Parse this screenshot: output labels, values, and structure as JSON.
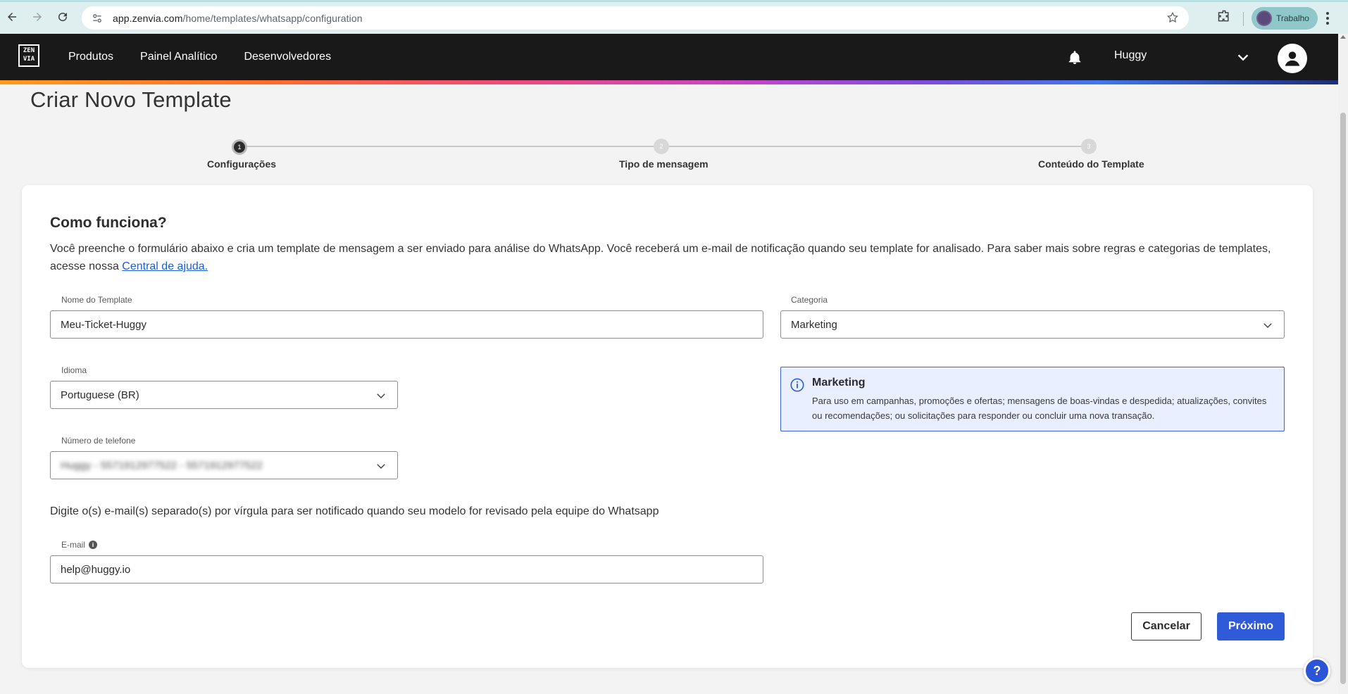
{
  "browser": {
    "url_host": "app.zenvia.com",
    "url_path": "/home/templates/whatsapp/configuration",
    "profile_label": "Trabalho",
    "icons": [
      "back-icon",
      "forward-icon",
      "reload-icon",
      "site-settings-icon",
      "bookmark-star-icon",
      "extensions-icon",
      "menu-kebab-icon"
    ]
  },
  "header": {
    "logo_text": "ZEN VIA",
    "nav": [
      "Produtos",
      "Painel Analítico",
      "Desenvolvedores"
    ],
    "account_name": "Huggy",
    "icons": [
      "bell-icon",
      "chevron-down-icon",
      "user-avatar-icon"
    ]
  },
  "page": {
    "title": "Criar Novo Template"
  },
  "stepper": {
    "steps": [
      {
        "number": "1",
        "label": "Configurações",
        "active": true
      },
      {
        "number": "2",
        "label": "Tipo de mensagem",
        "active": false
      },
      {
        "number": "3",
        "label": "Conteúdo do Template",
        "active": false
      }
    ]
  },
  "intro": {
    "title": "Como funciona?",
    "description": "Você preenche o formulário abaixo e cria um template de mensagem a ser enviado para análise do WhatsApp. Você receberá um e-mail de notificação quando seu template for analisado. Para saber mais sobre regras e categorias de templates, acesse nossa ",
    "link_text": "Central de ajuda."
  },
  "form": {
    "template_name": {
      "label": "Nome do Template",
      "value": "Meu-Ticket-Huggy"
    },
    "category": {
      "label": "Categoria",
      "value": "Marketing"
    },
    "language": {
      "label": "Idioma",
      "value": "Portuguese (BR)"
    },
    "phone": {
      "label": "Número de telefone",
      "value": "Huggy - 5571912977522 - 5571912977522"
    },
    "email_hint": "Digite o(s) e-mail(s) separado(s) por vírgula para ser notificado quando seu modelo for revisado pela equipe do Whatsapp",
    "email": {
      "label": "E-mail",
      "value": "help@huggy.io"
    }
  },
  "category_info": {
    "title": "Marketing",
    "text": "Para uso em campanhas, promoções e ofertas; mensagens de boas-vindas e despedida; atualizações, convites ou recomendações; ou solicitações para responder ou concluir uma nova transação."
  },
  "actions": {
    "cancel": "Cancelar",
    "next": "Próximo"
  },
  "colors": {
    "primary": "#2f5bd9",
    "header_bg": "#191919",
    "info_bg": "#e9efff",
    "link": "#1b5fd6"
  }
}
